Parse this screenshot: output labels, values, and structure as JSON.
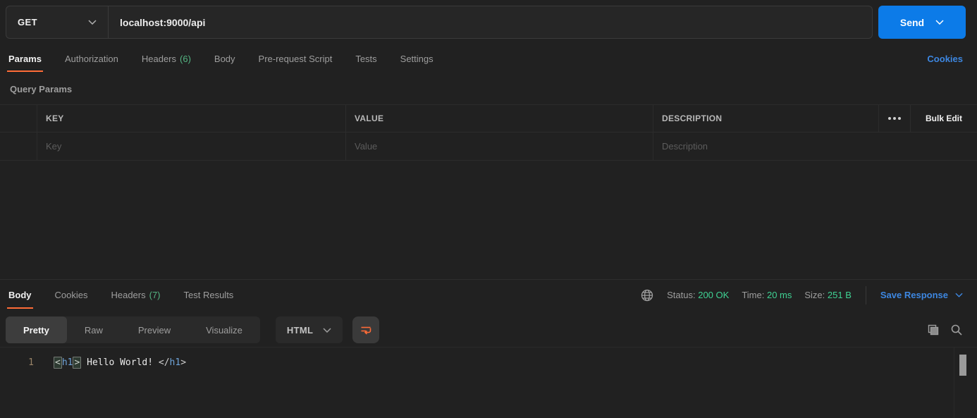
{
  "colors": {
    "accent_orange": "#ff6c37",
    "send_blue": "#0c7be8",
    "link_blue": "#3d87e1",
    "count_green": "#55b583",
    "status_green": "#3fd394"
  },
  "request_bar": {
    "method": "GET",
    "url": "localhost:9000/api",
    "send_label": "Send"
  },
  "request_tabs": {
    "params": "Params",
    "authorization": "Authorization",
    "headers": "Headers",
    "headers_count": "(6)",
    "body": "Body",
    "prerequest": "Pre-request Script",
    "tests": "Tests",
    "settings": "Settings",
    "cookies": "Cookies"
  },
  "query_params": {
    "title": "Query Params",
    "col_key": "KEY",
    "col_value": "VALUE",
    "col_description": "DESCRIPTION",
    "bulk_edit": "Bulk Edit",
    "ph_key": "Key",
    "ph_value": "Value",
    "ph_description": "Description"
  },
  "response": {
    "tab_body": "Body",
    "tab_cookies": "Cookies",
    "tab_headers": "Headers",
    "headers_count": "(7)",
    "tab_test_results": "Test Results",
    "status_label": "Status:",
    "status_value": "200 OK",
    "time_label": "Time:",
    "time_value": "20 ms",
    "size_label": "Size:",
    "size_value": "251 B",
    "save_response": "Save Response",
    "view_pretty": "Pretty",
    "view_raw": "Raw",
    "view_preview": "Preview",
    "view_visualize": "Visualize",
    "format": "HTML",
    "code_line_number": "1",
    "code_lt": "<",
    "code_tag_open": "h1",
    "code_gt": ">",
    "code_text": " Hello World! ",
    "code_close_start": "</",
    "code_tag_close": "h1",
    "code_close_end": ">"
  }
}
